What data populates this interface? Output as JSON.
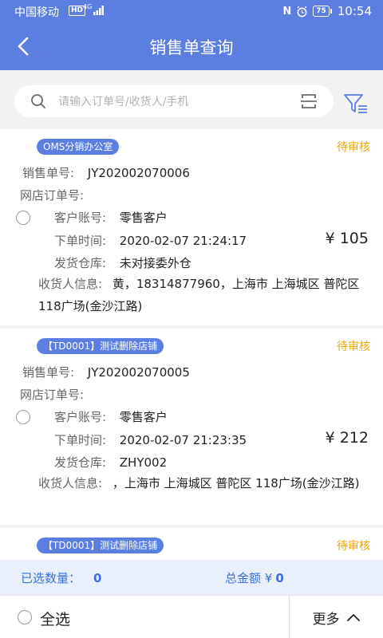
{
  "status_bar": {
    "carrier": "中国移动",
    "hd": "HD",
    "network": "4G",
    "battery": "75",
    "time": "10:54"
  },
  "nav": {
    "title": "销售单查询"
  },
  "search": {
    "placeholder": "请输入订单号/收货人/手机"
  },
  "labels": {
    "order_no": "销售单号:",
    "shop_order_no": "网店订单号:",
    "customer": "客户账号:",
    "order_time": "下单时间:",
    "warehouse": "发货仓库:",
    "receiver": "收货人信息:"
  },
  "orders": [
    {
      "shop": "OMS分销办公室",
      "status": "待审核",
      "order_no": "JY202002070006",
      "shop_order_no": "",
      "customer": "零售客户",
      "order_time": "2020-02-07 21:24:17",
      "amount": "¥ 105",
      "warehouse": "未对接委外仓",
      "receiver": "黄，18314877960，上海市 上海城区 普陀区 118广场(金沙江路)"
    },
    {
      "shop": "【TD0001】测试删除店铺",
      "status": "待审核",
      "order_no": "JY202002070005",
      "shop_order_no": "",
      "customer": "零售客户",
      "order_time": "2020-02-07 21:23:35",
      "amount": "¥ 212",
      "warehouse": "ZHY002",
      "receiver": "，上海市 上海城区 普陀区 118广场(金沙江路)"
    },
    {
      "shop": "【TD0001】测试删除店铺",
      "status": "待审核"
    }
  ],
  "summary": {
    "selected_label": "已选数量：",
    "selected_count": "0",
    "total_label": "总金额 ¥",
    "total_value": "0"
  },
  "bottom": {
    "select_all": "全选",
    "more": "更多"
  },
  "colors": {
    "primary": "#5b7fe0",
    "pending": "#f0a500"
  }
}
